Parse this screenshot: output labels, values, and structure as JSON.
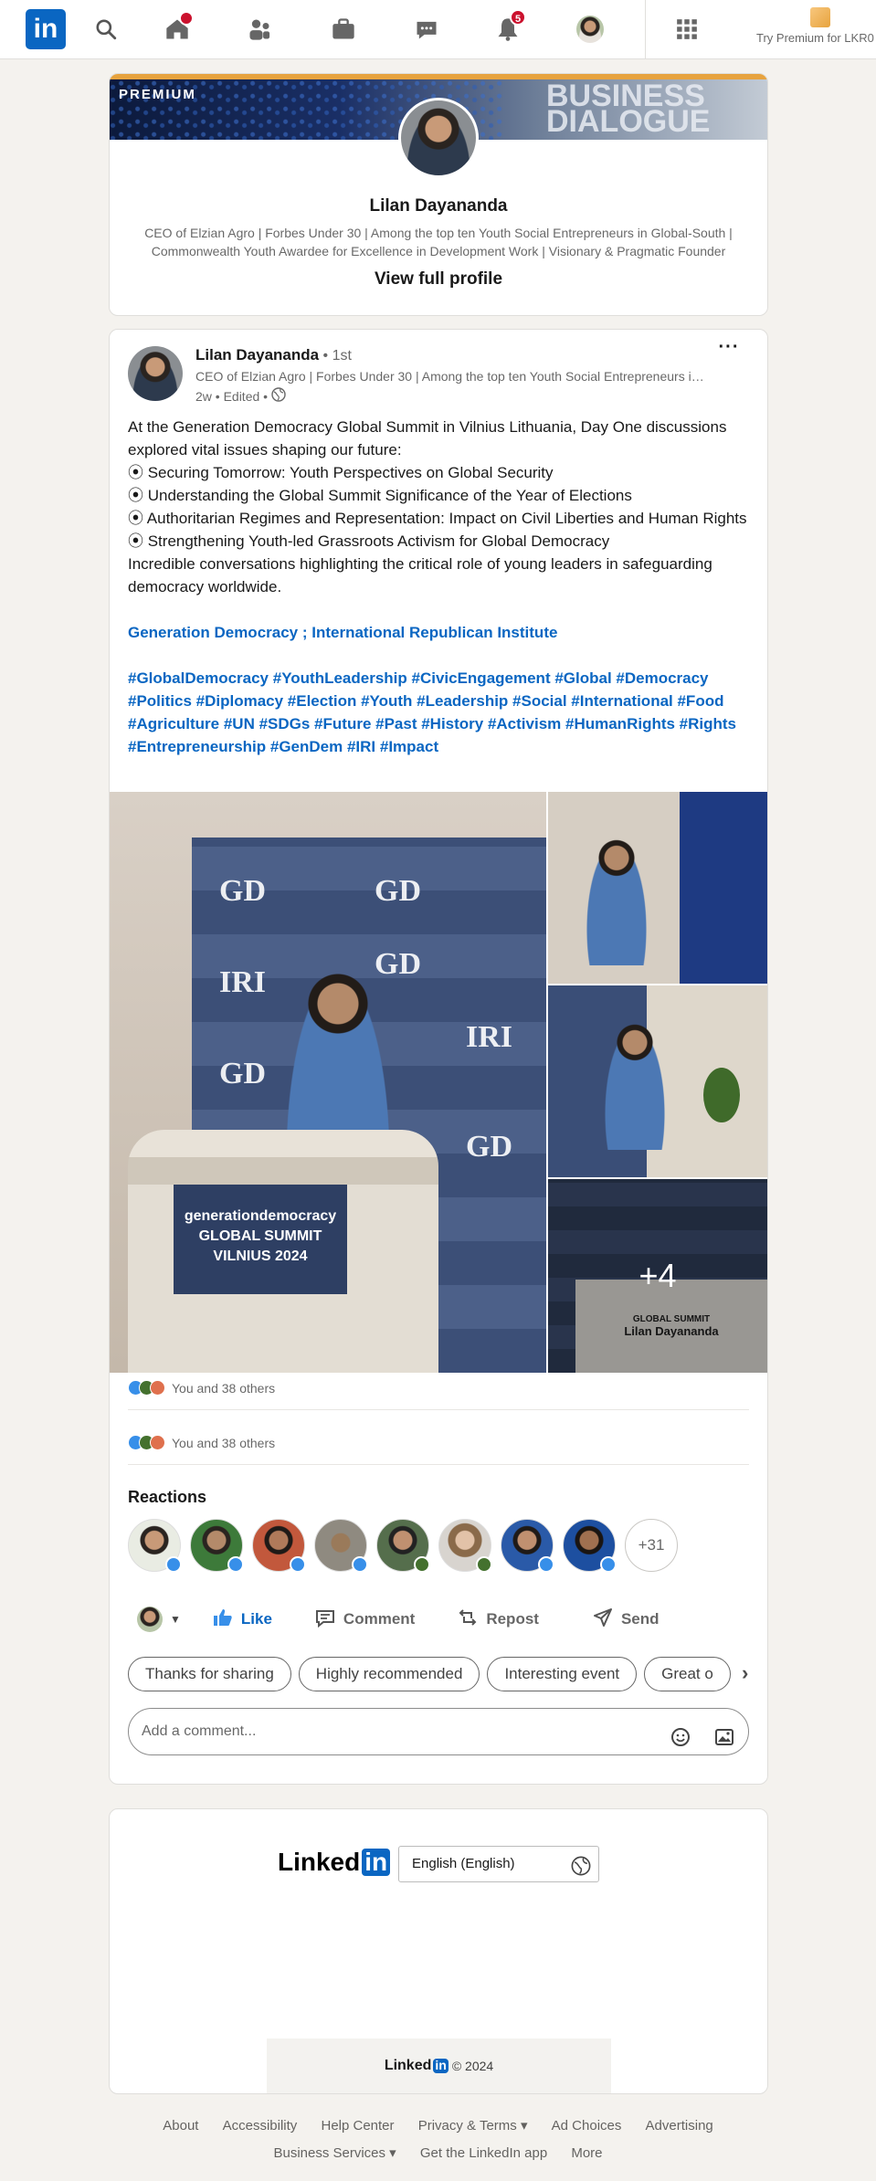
{
  "nav": {
    "logo": "in",
    "home_badge": "",
    "notifications_badge": "5",
    "premium_text": "Try Premium for LKR0"
  },
  "profile_card": {
    "premium_tag": "PREMIUM",
    "cover_text": "BUSINESS DIALOGUE",
    "name": "Lilan Dayananda",
    "headline": "CEO of Elzian Agro | Forbes Under 30 | Among the top ten Youth Social Entrepreneurs in Global-South | Commonwealth Youth Awardee for Excellence in Development Work | Visionary & Pragmatic Founder",
    "view_profile": "View full profile"
  },
  "post": {
    "author": "Lilan Dayananda",
    "degree": " • 1st",
    "headline": "CEO of Elzian Agro | Forbes Under 30 | Among the top ten Youth Social Entrepreneurs in Global-South | Commonwealth Youth Awardee",
    "meta": "2w • Edited •",
    "more": "···",
    "lines": [
      "At the Generation Democracy Global Summit in Vilnius Lithuania, Day One discussions explored vital issues shaping our future:",
      "⦿ Securing Tomorrow: Youth Perspectives on Global Security",
      "⦿ Understanding the Global Summit Significance of the Year of Elections",
      "⦿ Authoritarian Regimes and Representation: Impact on Civil Liberties and Human Rights",
      "⦿ Strengthening Youth-led Grassroots Activism for Global Democracy",
      "Incredible conversations highlighting the critical role of young leaders in safeguarding democracy worldwide."
    ],
    "mention_1": "Generation Democracy",
    "mention_sep": " ; ",
    "mention_2": "International Republican Institute",
    "hashtags": "#GlobalDemocracy #YouthLeadership #CivicEngagement #Global #Democracy #Politics #Diplomacy #Election #Youth #Leadership #Social #International #Food #Agriculture #UN #SDGs #Future #Past #History #Activism #HumanRights #Rights #Entrepreneurship #GenDem #IRI #Impact",
    "photos": {
      "main_banner_words": [
        "GD",
        "IRI"
      ],
      "podium_text": "generationdemocracy GLOBAL SUMMIT VILNIUS 2024",
      "sign_name": "Lilan Dayananda",
      "sign_title": "GLOBAL SUMMIT",
      "more_count": "+4"
    },
    "reactions_summary_1": "You and 38 others",
    "reactions_summary_2": "You and 38 others",
    "reactions_title": "Reactions",
    "reactions_more": "+31",
    "actions": {
      "like": "Like",
      "comment": "Comment",
      "repost": "Repost",
      "send": "Send"
    },
    "suggestions": [
      "Thanks for sharing",
      "Highly recommended",
      "Interesting event",
      "Great o"
    ],
    "comment_placeholder": "Add a comment..."
  },
  "footer": {
    "wordmark": "Linked",
    "wordmark_in": "in",
    "language": "English (English)",
    "copyright": "© 2024",
    "links_row1": [
      "About",
      "Accessibility",
      "Help Center",
      "Privacy & Terms ▾",
      "Ad Choices",
      "Advertising"
    ],
    "links_row2": [
      "Business Services ▾",
      "Get the LinkedIn app",
      "More"
    ]
  },
  "colors": {
    "brand": "#0a66c2",
    "premium_gold": "#e7a33e",
    "badge_red": "#cb112d"
  }
}
